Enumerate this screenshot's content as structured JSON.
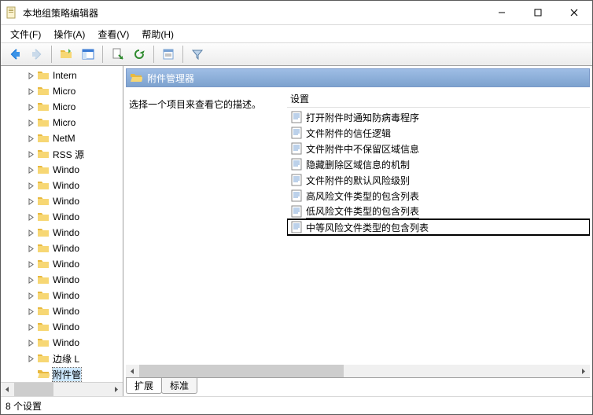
{
  "window": {
    "title": "本地组策略编辑器"
  },
  "menu": {
    "file": "文件(F)",
    "action": "操作(A)",
    "view": "查看(V)",
    "help": "帮助(H)"
  },
  "tree": {
    "items": [
      {
        "label": "Intern"
      },
      {
        "label": "Micro"
      },
      {
        "label": "Micro"
      },
      {
        "label": "Micro"
      },
      {
        "label": "NetM"
      },
      {
        "label": "RSS 源"
      },
      {
        "label": "Windo"
      },
      {
        "label": "Windo"
      },
      {
        "label": "Windo"
      },
      {
        "label": "Windo"
      },
      {
        "label": "Windo"
      },
      {
        "label": "Windo"
      },
      {
        "label": "Windo"
      },
      {
        "label": "Windo"
      },
      {
        "label": "Windo"
      },
      {
        "label": "Windo"
      },
      {
        "label": "Windo"
      },
      {
        "label": "Windo"
      },
      {
        "label": "边缘 L"
      },
      {
        "label": "附件管",
        "selected": true,
        "collapsable": false
      }
    ]
  },
  "right": {
    "header": "附件管理器",
    "desc": "选择一个项目来查看它的描述。",
    "colheader": "设置",
    "items": [
      {
        "label": "打开附件时通知防病毒程序"
      },
      {
        "label": "文件附件的信任逻辑"
      },
      {
        "label": "文件附件中不保留区域信息"
      },
      {
        "label": "隐藏删除区域信息的机制"
      },
      {
        "label": "文件附件的默认风险级别"
      },
      {
        "label": "高风险文件类型的包含列表"
      },
      {
        "label": "低风险文件类型的包含列表",
        "underlined": true
      },
      {
        "label": "中等风险文件类型的包含列表",
        "boxed": true
      }
    ],
    "tabs": {
      "extended": "扩展",
      "standard": "标准"
    }
  },
  "status": "8 个设置"
}
